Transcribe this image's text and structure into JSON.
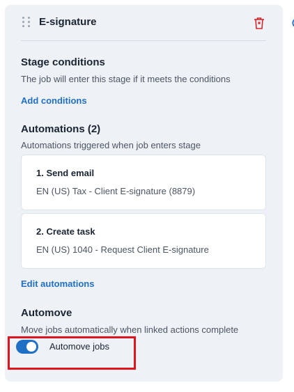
{
  "stage": {
    "title": "E-signature"
  },
  "conditions": {
    "title": "Stage conditions",
    "description": "The job will enter this stage if it meets the conditions",
    "add_link": "Add conditions"
  },
  "automations": {
    "title": "Automations (2)",
    "description": "Automations triggered when job enters stage",
    "items": [
      {
        "title": "1. Send email",
        "detail": "EN (US) Tax - Client E-signature (8879)"
      },
      {
        "title": "2. Create task",
        "detail": "EN (US) 1040 - Request Client E-signature"
      }
    ],
    "edit_link": "Edit automations"
  },
  "automove": {
    "title": "Automove",
    "description": "Move jobs automatically when linked actions complete",
    "toggle_label": "Automove jobs",
    "enabled": true
  },
  "colors": {
    "accent": "#1f6fc5",
    "delete": "#d9252c",
    "highlight": "#e0141e",
    "panel_bg": "#eef1f6"
  },
  "icons": {
    "drag": "drag-handle-icon",
    "delete": "trash-icon",
    "edge": "partial-circle-icon"
  }
}
